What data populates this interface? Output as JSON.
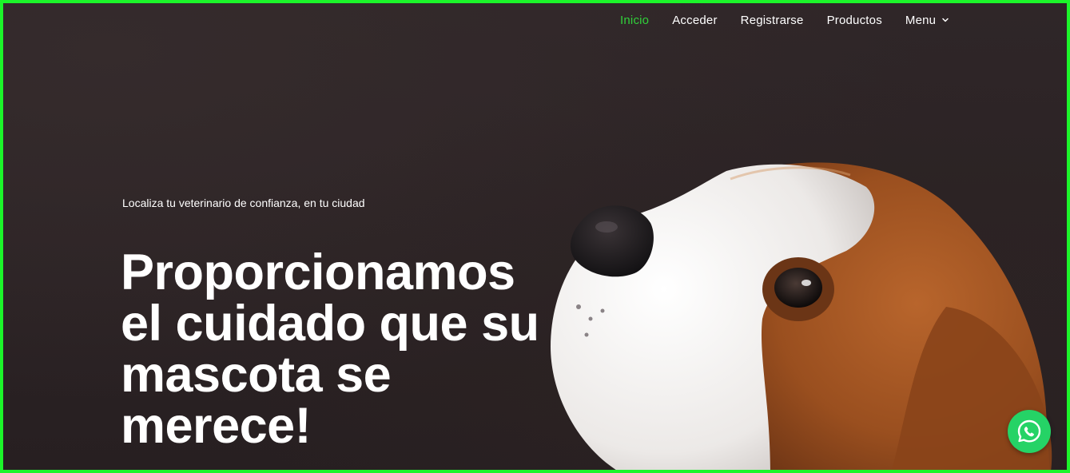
{
  "nav": {
    "items": [
      {
        "label": "Inicio",
        "active": true
      },
      {
        "label": "Acceder",
        "active": false
      },
      {
        "label": "Registrarse",
        "active": false
      },
      {
        "label": "Productos",
        "active": false
      },
      {
        "label": "Menu",
        "active": false,
        "icon": "chevron-down-icon"
      }
    ]
  },
  "hero": {
    "tagline": "Localiza tu veterinario de confianza, en tu ciudad",
    "headline": "Proporcionamos el cuidado que su mascota se merece!",
    "image": "beagle-dog-photo"
  },
  "whatsapp": {
    "icon": "whatsapp-icon"
  },
  "colors": {
    "accent": "#30d03a",
    "background": "#2a2224",
    "frame_border": "#1cf52a",
    "whatsapp": "#25d366"
  }
}
